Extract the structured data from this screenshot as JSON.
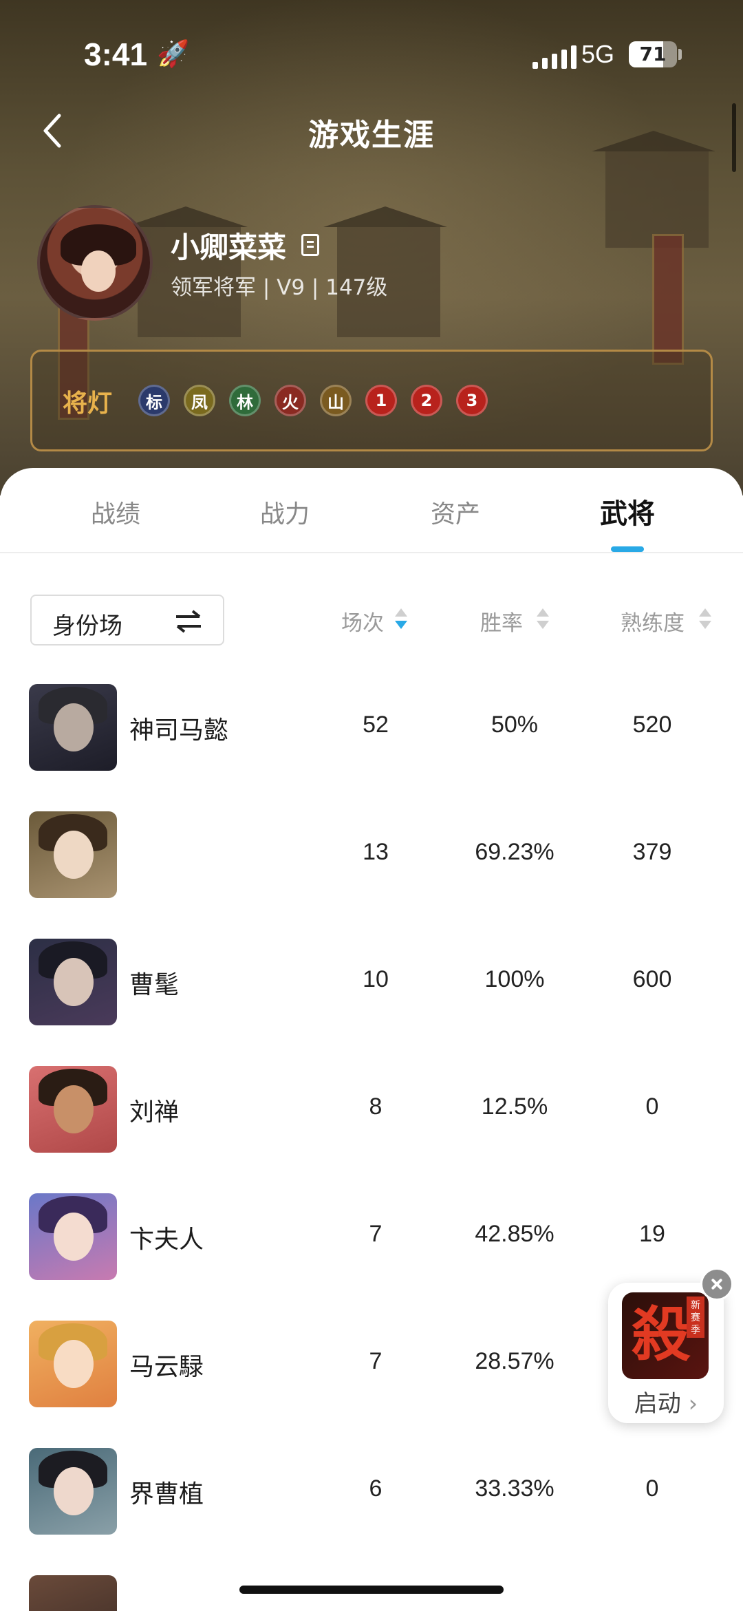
{
  "status_bar": {
    "time": "3:41",
    "network": "5G",
    "battery": "71",
    "battery_level": 0.71
  },
  "nav": {
    "title": "游戏生涯"
  },
  "profile": {
    "name": "小卿菜菜",
    "subline": "领军将军 | V9 | 147级"
  },
  "lamps": {
    "label": "将灯",
    "items": [
      {
        "text": "标",
        "color": "#2b3a6b"
      },
      {
        "text": "凤",
        "color": "#7a6a1e"
      },
      {
        "text": "林",
        "color": "#2f6b3a"
      },
      {
        "text": "火",
        "color": "#8a2a22"
      },
      {
        "text": "山",
        "color": "#7a5a20"
      },
      {
        "text": "1",
        "color": "#b8221c"
      },
      {
        "text": "2",
        "color": "#b8221c"
      },
      {
        "text": "3",
        "color": "#b8221c"
      }
    ]
  },
  "tabs": [
    "战绩",
    "战力",
    "资产",
    "武将"
  ],
  "active_tab": "武将",
  "filter": {
    "label": "身份场"
  },
  "columns": [
    "场次",
    "胜率",
    "熟练度"
  ],
  "accent_color": "#29a9e6",
  "heroes": [
    {
      "name": "神司马懿",
      "games": "52",
      "winrate": "50%",
      "mastery": "520"
    },
    {
      "name": "",
      "games": "13",
      "winrate": "69.23%",
      "mastery": "379"
    },
    {
      "name": "曹髦",
      "games": "10",
      "winrate": "100%",
      "mastery": "600"
    },
    {
      "name": "刘禅",
      "games": "8",
      "winrate": "12.5%",
      "mastery": "0"
    },
    {
      "name": "卞夫人",
      "games": "7",
      "winrate": "42.85%",
      "mastery": "19"
    },
    {
      "name": "马云騄",
      "games": "7",
      "winrate": "28.57%",
      "mastery": ""
    },
    {
      "name": "界曹植",
      "games": "6",
      "winrate": "33.33%",
      "mastery": "0"
    }
  ],
  "ad": {
    "cta": "启动",
    "glyph": "殺",
    "tag": "新赛季"
  }
}
